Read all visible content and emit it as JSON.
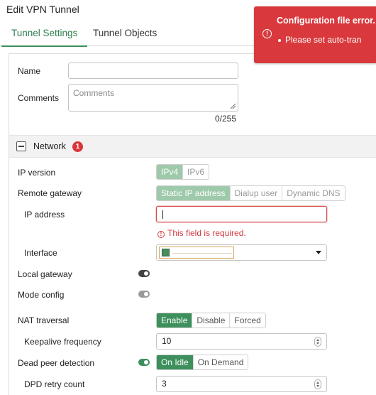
{
  "window": {
    "title": "Edit VPN Tunnel"
  },
  "tabs": [
    {
      "label": "Tunnel Settings",
      "active": true
    },
    {
      "label": "Tunnel Objects",
      "active": false
    }
  ],
  "form": {
    "name": {
      "label": "Name",
      "value": ""
    },
    "comments": {
      "label": "Comments",
      "placeholder": "Comments",
      "value": "",
      "counter": "0/255"
    }
  },
  "network": {
    "title": "Network",
    "error_count": "1",
    "ip_version": {
      "label": "IP version",
      "options": [
        "IPv4",
        "IPv6"
      ],
      "selected": "IPv4",
      "disabled": true
    },
    "remote_gateway": {
      "label": "Remote gateway",
      "options": [
        "Static IP address",
        "Dialup user",
        "Dynamic DNS"
      ],
      "selected": "Static IP address",
      "disabled": true
    },
    "ip_address": {
      "label": "IP address",
      "value": "",
      "error": "This field is required."
    },
    "interface": {
      "label": "Interface",
      "value": ""
    },
    "local_gateway": {
      "label": "Local gateway",
      "enabled": false
    },
    "mode_config": {
      "label": "Mode config",
      "enabled": false
    },
    "nat_traversal": {
      "label": "NAT traversal",
      "options": [
        "Enable",
        "Disable",
        "Forced"
      ],
      "selected": "Enable"
    },
    "keepalive_frequency": {
      "label": "Keepalive frequency",
      "value": "10"
    },
    "dead_peer_detection": {
      "label": "Dead peer detection",
      "enabled": true,
      "options": [
        "On Idle",
        "On Demand"
      ],
      "selected": "On Idle"
    },
    "dpd_retry_count": {
      "label": "DPD retry count",
      "value": "3"
    }
  },
  "toast": {
    "title": "Configuration file error.",
    "message": "Please set auto-tran"
  },
  "colors": {
    "accent": "#3d8f5c",
    "error": "#d9393d"
  }
}
